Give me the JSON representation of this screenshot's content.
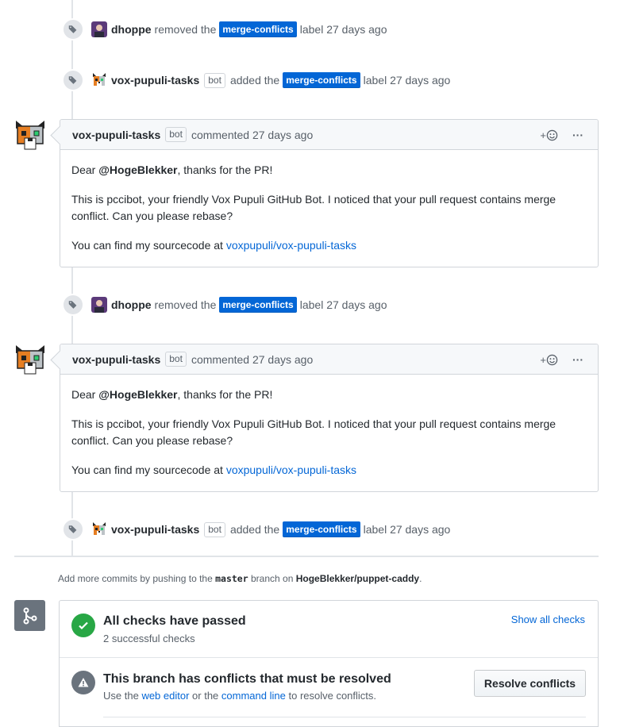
{
  "events": [
    {
      "actor": "dhoppe",
      "is_bot": false,
      "action": "removed the",
      "label": "merge-conflicts",
      "suffix": "label 27 days ago"
    },
    {
      "actor": "vox-pupuli-tasks",
      "is_bot": true,
      "bot_badge": "bot",
      "action": "added the",
      "label": "merge-conflicts",
      "suffix": "label 27 days ago"
    },
    {
      "actor": "dhoppe",
      "is_bot": false,
      "action": "removed the",
      "label": "merge-conflicts",
      "suffix": "label 27 days ago"
    },
    {
      "actor": "vox-pupuli-tasks",
      "is_bot": true,
      "bot_badge": "bot",
      "action": "added the",
      "label": "merge-conflicts",
      "suffix": "label 27 days ago"
    }
  ],
  "comments": [
    {
      "author": "vox-pupuli-tasks",
      "bot_badge": "bot",
      "meta": "commented 27 days ago",
      "reaction": "+",
      "more": "···",
      "greeting_prefix": "Dear",
      "mention": "@HogeBlekker",
      "greeting_suffix": ", thanks for the PR!",
      "paragraph": "This is pccibot, your friendly Vox Pupuli GitHub Bot. I noticed that your pull request contains merge conflict. Can you please rebase?",
      "source_prefix": "You can find my sourcecode at",
      "source_link": "voxpupuli/vox-pupuli-tasks"
    },
    {
      "author": "vox-pupuli-tasks",
      "bot_badge": "bot",
      "meta": "commented 27 days ago",
      "reaction": "+",
      "more": "···",
      "greeting_prefix": "Dear",
      "mention": "@HogeBlekker",
      "greeting_suffix": ", thanks for the PR!",
      "paragraph": "This is pccibot, your friendly Vox Pupuli GitHub Bot. I noticed that your pull request contains merge conflict. Can you please rebase?",
      "source_prefix": "You can find my sourcecode at",
      "source_link": "voxpupuli/vox-pupuli-tasks"
    }
  ],
  "push_hint": {
    "prefix": "Add more commits by pushing to the",
    "branch": "master",
    "middle": "branch on",
    "repo": "HogeBlekker/puppet-caddy",
    "end": "."
  },
  "checks": {
    "title": "All checks have passed",
    "subtitle": "2 successful checks",
    "link": "Show all checks"
  },
  "conflicts": {
    "title": "This branch has conflicts that must be resolved",
    "sub_prefix": "Use the",
    "web_editor": "web editor",
    "sub_middle": "or the",
    "command_line": "command line",
    "sub_suffix": "to resolve conflicts.",
    "button": "Resolve conflicts"
  },
  "colors": {
    "label_bg": "#0366d6",
    "success": "#28a745",
    "link": "#0366d6"
  }
}
